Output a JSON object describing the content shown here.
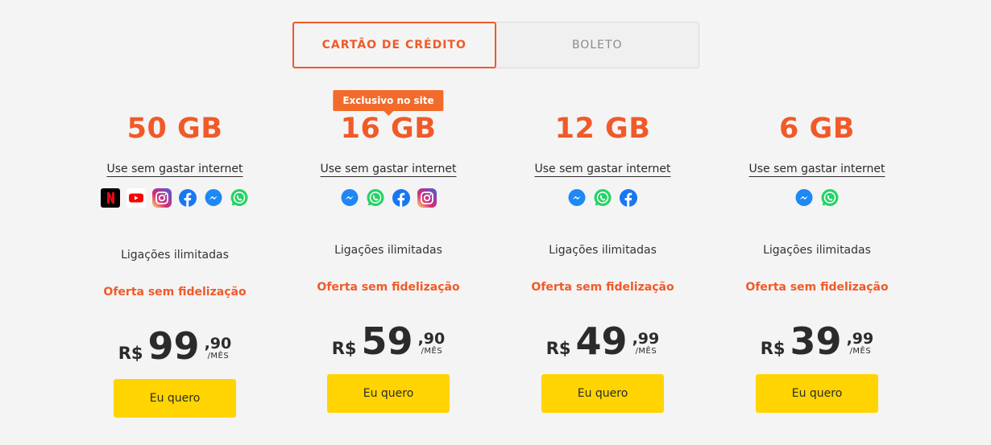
{
  "tabs": [
    {
      "label": "CARTÃO DE CRÉDITO",
      "active": true
    },
    {
      "label": "BOLETO",
      "active": false
    }
  ],
  "colors": {
    "accent": "#f05a28",
    "cta": "#ffd400",
    "background": "#f4f4f4"
  },
  "plans": [
    {
      "gb": "50 GB",
      "use_link": "Use sem gastar internet",
      "apps": [
        "netflix-icon",
        "youtube-icon",
        "instagram-icon",
        "facebook-icon",
        "messenger-icon",
        "whatsapp-icon"
      ],
      "calls": "Ligações ilimitadas",
      "offer": "Oferta sem fidelização",
      "currency": "R$",
      "price_int": "99",
      "price_dec": ",90",
      "per": "/MÊS",
      "cta": "Eu quero"
    },
    {
      "badge": "Exclusivo no site",
      "gb": "16 GB",
      "use_link": "Use sem gastar internet",
      "apps": [
        "messenger-icon",
        "whatsapp-icon",
        "facebook-icon",
        "instagram-icon"
      ],
      "calls": "Ligações ilimitadas",
      "offer": "Oferta sem fidelização",
      "currency": "R$",
      "price_int": "59",
      "price_dec": ",90",
      "per": "/MÊS",
      "cta": "Eu quero"
    },
    {
      "gb": "12 GB",
      "use_link": "Use sem gastar internet",
      "apps": [
        "messenger-icon",
        "whatsapp-icon",
        "facebook-icon"
      ],
      "calls": "Ligações ilimitadas",
      "offer": "Oferta sem fidelização",
      "currency": "R$",
      "price_int": "49",
      "price_dec": ",99",
      "per": "/MÊS",
      "cta": "Eu quero"
    },
    {
      "gb": "6 GB",
      "use_link": "Use sem gastar internet",
      "apps": [
        "messenger-icon",
        "whatsapp-icon"
      ],
      "calls": "Ligações ilimitadas",
      "offer": "Oferta sem fidelização",
      "currency": "R$",
      "price_int": "39",
      "price_dec": ",99",
      "per": "/MÊS",
      "cta": "Eu quero"
    }
  ]
}
